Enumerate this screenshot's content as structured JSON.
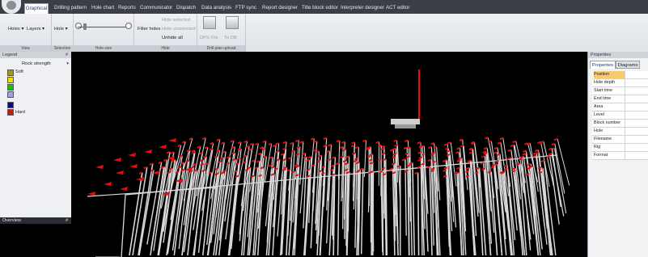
{
  "menu": {
    "tabs": [
      {
        "label": "Graphical",
        "active": true
      },
      {
        "label": "Drilling pattern",
        "active": false
      },
      {
        "label": "Hole chart",
        "active": false
      },
      {
        "label": "Reports",
        "active": false
      },
      {
        "label": "Communicator",
        "active": false
      },
      {
        "label": "Dispatch",
        "active": false
      },
      {
        "label": "Data analysis",
        "active": false
      },
      {
        "label": "FTP sync",
        "active": false
      },
      {
        "label": "Report designer",
        "active": false
      },
      {
        "label": "Title block editor",
        "active": false
      },
      {
        "label": "Interpreter designer",
        "active": false
      },
      {
        "label": "ACT editor",
        "active": false
      }
    ]
  },
  "ribbon": {
    "view": {
      "holes_label": "Holes",
      "layers_label": "Layers",
      "group_label": "View"
    },
    "selection": {
      "hole_label": "Hole",
      "group_label": "Selection"
    },
    "hole_size": {
      "group_label": "Hole size"
    },
    "hide": {
      "filter_holes_label": "Filter holes",
      "hide_selected_label": "Hide selected",
      "hide_unselected_label": "Hide unselected",
      "unhide_all_label": "Unhide all",
      "group_label": "Hide"
    },
    "upload": {
      "dps_file_label": "DPS File",
      "to_db_label": "To DB",
      "group_label": "Drill plan upload"
    }
  },
  "legend": {
    "title": "Legend",
    "pin": "#",
    "header": "Rock strength",
    "chevron": "▾",
    "items": [
      {
        "label": "Soft",
        "color": "#a29a14"
      },
      {
        "label": "",
        "color": "#f0e000"
      },
      {
        "label": "",
        "color": "#18c018"
      },
      {
        "label": "",
        "color": "#9da2dc"
      },
      {
        "label": "",
        "color": "#0c0c7a"
      },
      {
        "label": "Hard",
        "color": "#c81818"
      }
    ]
  },
  "overview": {
    "title": "Overview",
    "pin": "#"
  },
  "properties": {
    "title": "Properties",
    "tabs": [
      {
        "label": "Properties",
        "active": true
      },
      {
        "label": "Diagrams",
        "active": false
      }
    ],
    "rows": [
      {
        "name": "Position",
        "selected": true
      },
      {
        "name": "Hole depth",
        "selected": false
      },
      {
        "name": "Start time",
        "selected": false
      },
      {
        "name": "End time",
        "selected": false
      },
      {
        "name": "Area",
        "selected": false
      },
      {
        "name": "Level",
        "selected": false
      },
      {
        "name": "Block number",
        "selected": false
      },
      {
        "name": "Hole",
        "selected": false
      },
      {
        "name": "Filename",
        "selected": false
      },
      {
        "name": "Rig",
        "selected": false
      },
      {
        "name": "Format",
        "selected": false
      }
    ]
  },
  "viewport": {
    "background": "#000000",
    "hole_color": "#d8d8d8",
    "hole_tip_color": "#e01010",
    "axis_color": "#e01010"
  }
}
